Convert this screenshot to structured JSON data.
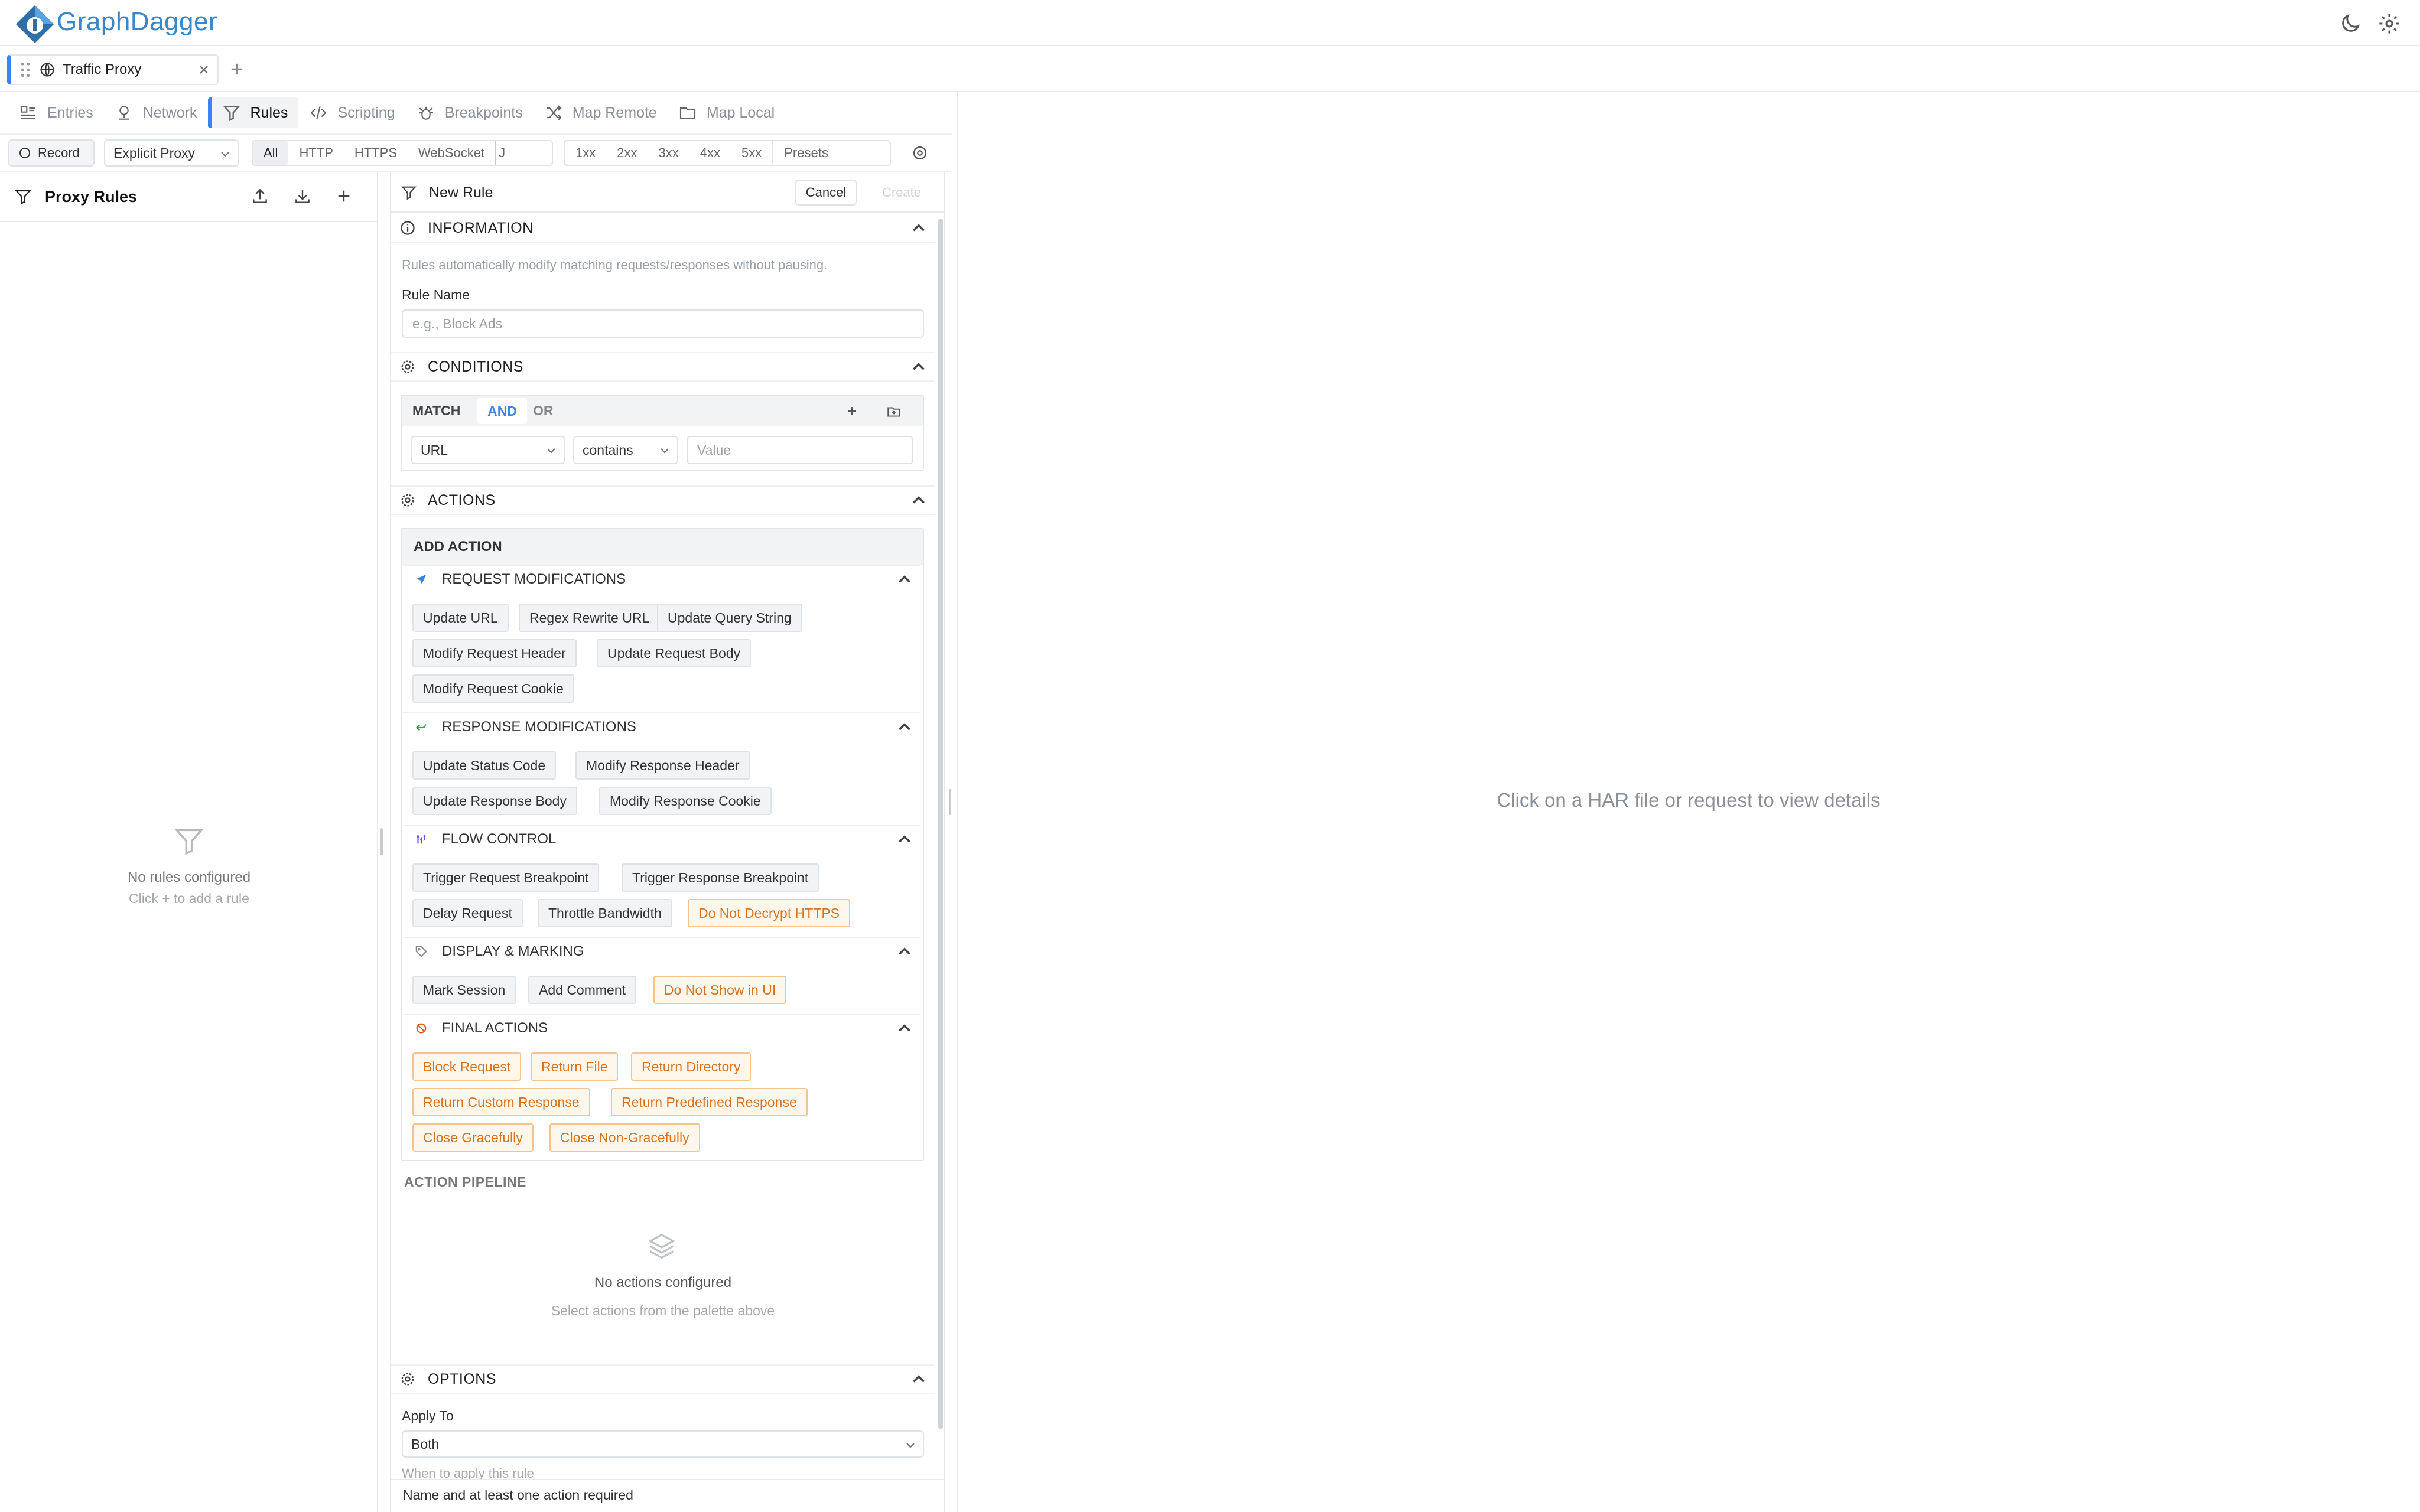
{
  "app": {
    "brand": "GraphDagger"
  },
  "tabs": [
    {
      "label": "Traffic Proxy"
    }
  ],
  "nav": {
    "items": [
      {
        "label": "Entries"
      },
      {
        "label": "Network"
      },
      {
        "label": "Rules"
      },
      {
        "label": "Scripting"
      },
      {
        "label": "Breakpoints"
      },
      {
        "label": "Map Remote"
      },
      {
        "label": "Map Local"
      }
    ]
  },
  "toolbar": {
    "record": "Record",
    "proxy_mode": "Explicit Proxy",
    "protocols": [
      "All",
      "HTTP",
      "HTTPS",
      "WebSocket",
      "J"
    ],
    "status_filters": [
      "1xx",
      "2xx",
      "3xx",
      "4xx",
      "5xx",
      "Presets"
    ]
  },
  "left": {
    "title": "Proxy Rules",
    "empty_title": "No rules configured",
    "empty_hint": "Click + to add a rule"
  },
  "editor": {
    "title": "New Rule",
    "cancel": "Cancel",
    "create": "Create",
    "information": {
      "header": "INFORMATION",
      "description": "Rules automatically modify matching requests/responses without pausing.",
      "rule_name_label": "Rule Name",
      "rule_name_placeholder": "e.g., Block Ads"
    },
    "conditions": {
      "header": "CONDITIONS",
      "match": "MATCH",
      "and": "AND",
      "or": "OR",
      "field": "URL",
      "operator": "contains",
      "value_placeholder": "Value"
    },
    "actions": {
      "header": "ACTIONS",
      "add_action": "ADD ACTION",
      "request": {
        "title": "REQUEST MODIFICATIONS",
        "items": [
          "Update URL",
          "Regex Rewrite URL",
          "Update Query String",
          "Modify Request Header",
          "Update Request Body",
          "Modify Request Cookie"
        ]
      },
      "response": {
        "title": "RESPONSE MODIFICATIONS",
        "items": [
          "Update Status Code",
          "Modify Response Header",
          "Update Response Body",
          "Modify Response Cookie"
        ]
      },
      "flow": {
        "title": "FLOW CONTROL",
        "items": [
          "Trigger Request Breakpoint",
          "Trigger Response Breakpoint",
          "Delay Request",
          "Throttle Bandwidth",
          "Do Not Decrypt HTTPS"
        ]
      },
      "display": {
        "title": "DISPLAY & MARKING",
        "items": [
          "Mark Session",
          "Add Comment",
          "Do Not Show in UI"
        ]
      },
      "final": {
        "title": "FINAL ACTIONS",
        "items": [
          "Block Request",
          "Return File",
          "Return Directory",
          "Return Custom Response",
          "Return Predefined Response",
          "Close Gracefully",
          "Close Non-Gracefully"
        ]
      },
      "pipeline": {
        "title": "ACTION PIPELINE",
        "empty_title": "No actions configured",
        "empty_hint": "Select actions from the palette above"
      }
    },
    "options": {
      "header": "OPTIONS",
      "apply_to_label": "Apply To",
      "apply_to_value": "Both",
      "apply_hint": "When to apply this rule"
    },
    "footer": "Name and at least one action required"
  },
  "detail": {
    "placeholder": "Click on a HAR file or request to view details"
  },
  "colors": {
    "accent": "#3b82f6",
    "warning": "#d9731f",
    "brand": "#3a86c8"
  }
}
